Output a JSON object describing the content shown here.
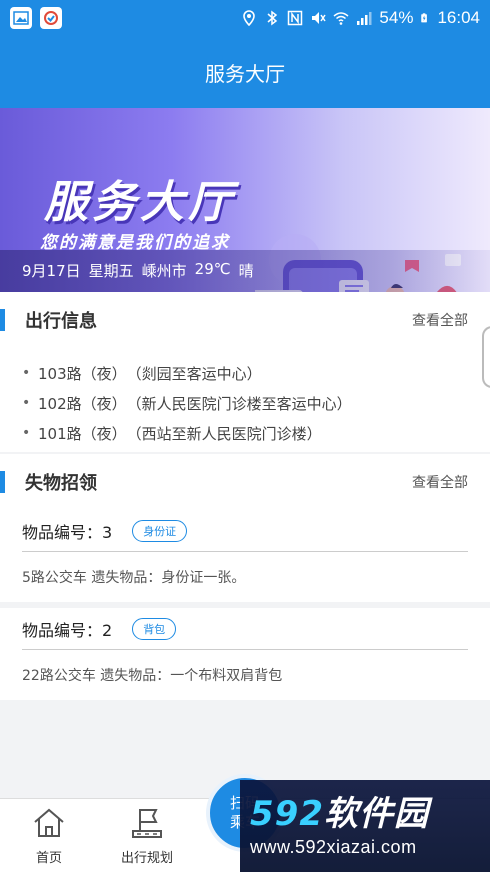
{
  "status_bar": {
    "battery": "54%",
    "time": "16:04"
  },
  "header": {
    "title": "服务大厅"
  },
  "banner": {
    "title": "服务大厅",
    "subtitle": "您的满意是我们的追求",
    "date": "9月17日",
    "weekday": "星期五",
    "city": "嵊州市",
    "temperature": "29℃",
    "weather": "晴",
    "rating_stars": "★★★★"
  },
  "travel_info": {
    "title": "出行信息",
    "more_label": "查看全部",
    "routes": [
      {
        "route": "103路（夜）",
        "desc": "（剡园至客运中心）"
      },
      {
        "route": "102路（夜）",
        "desc": "（新人民医院门诊楼至客运中心）"
      },
      {
        "route": "101路（夜）",
        "desc": "（西站至新人民医院门诊楼）"
      }
    ]
  },
  "lost_found": {
    "title": "失物招领",
    "more_label": "查看全部",
    "items": [
      {
        "label": "物品编号：3",
        "tag": "身份证",
        "desc": "5路公交车 遗失物品：身份证一张。"
      },
      {
        "label": "物品编号：2",
        "tag": "背包",
        "desc": "22路公交车 遗失物品：一个布料双肩背包"
      }
    ]
  },
  "bottom_nav": {
    "items": [
      {
        "label": "首页",
        "icon": "home-icon"
      },
      {
        "label": "出行规划",
        "icon": "route-flag-icon"
      }
    ],
    "scan_button": {
      "line1": "扫码",
      "line2": "乘车"
    }
  },
  "watermark": {
    "brand_num": "592",
    "brand_cn": "软件园",
    "url": "www.592xiazai.com"
  },
  "colors": {
    "primary": "#1e8be3",
    "banner_purple": "#6a5bd9"
  }
}
